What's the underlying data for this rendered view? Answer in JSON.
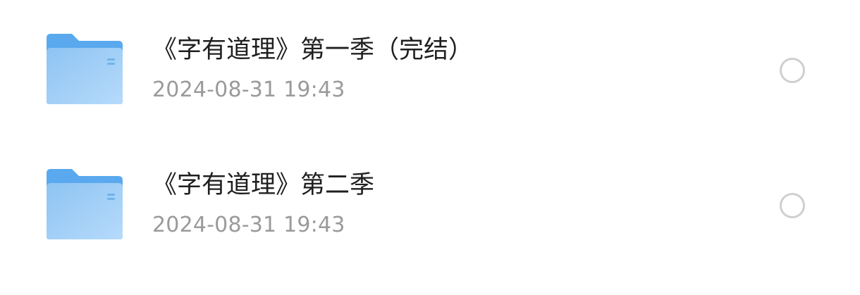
{
  "colors": {
    "folder_back": "#5aa9ee",
    "folder_front_start": "#8ec4f2",
    "folder_front_end": "#b6dafb",
    "title_text": "#1f1f1f",
    "meta_text": "#9a9a9a",
    "radio_border": "#cfcfcf"
  },
  "files": [
    {
      "name": "《字有道理》第一季（完结）",
      "modified": "2024-08-31 19:43",
      "icon": "folder-icon",
      "selected": false
    },
    {
      "name": "《字有道理》第二季",
      "modified": "2024-08-31 19:43",
      "icon": "folder-icon",
      "selected": false
    }
  ]
}
